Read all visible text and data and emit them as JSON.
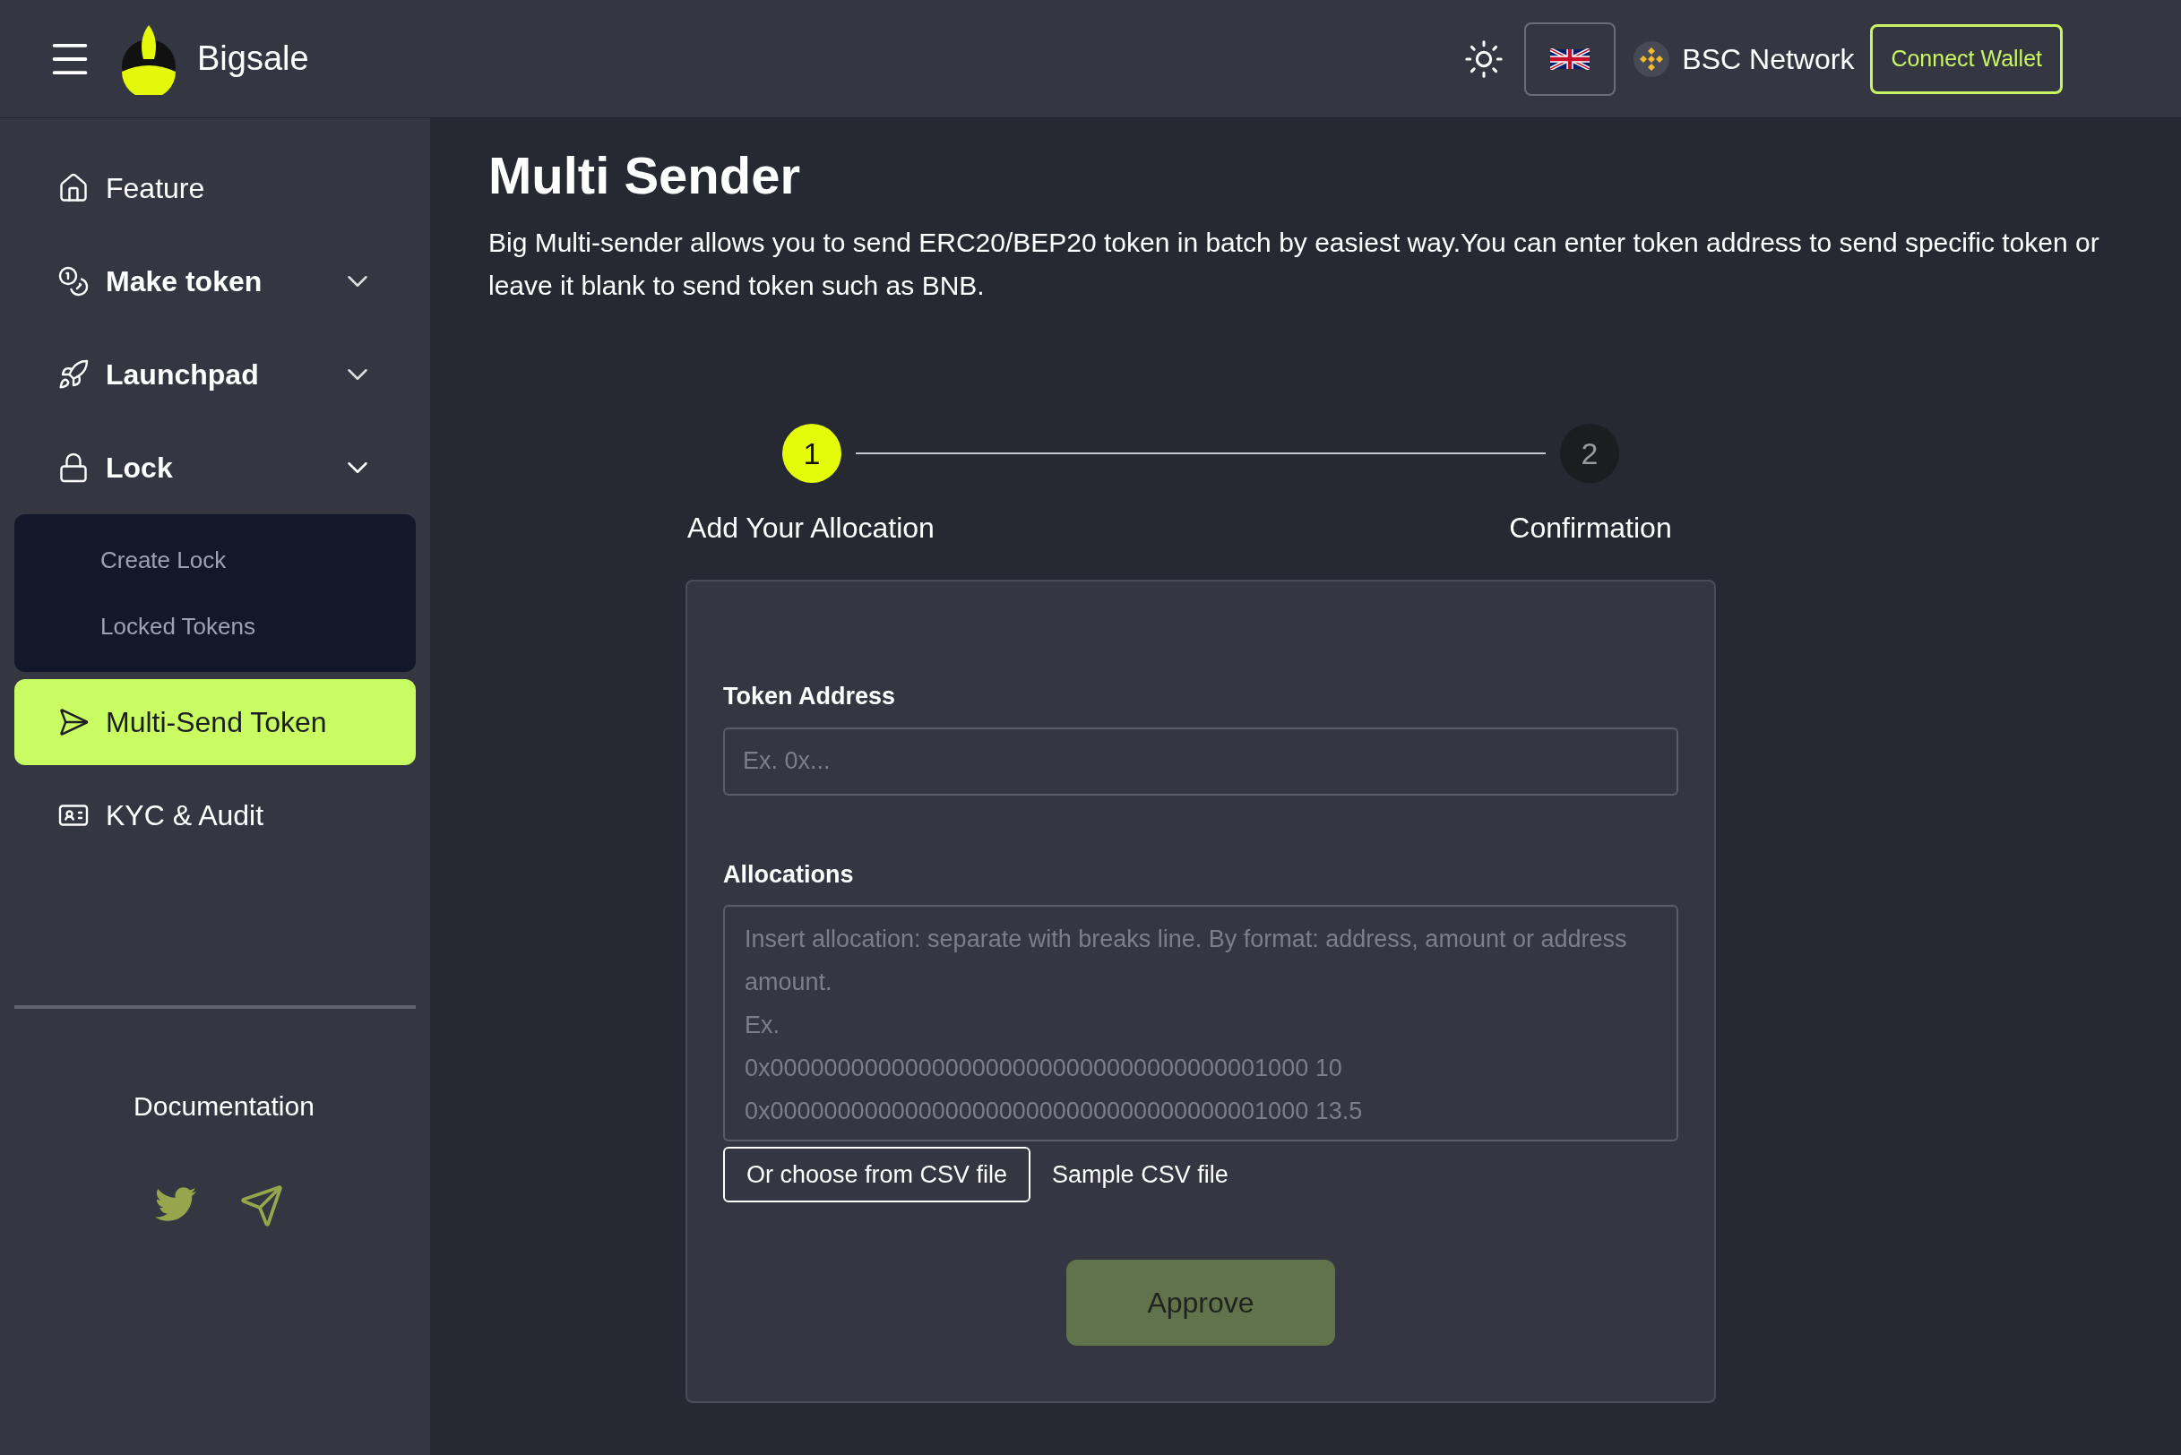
{
  "header": {
    "brand": "Bigsale",
    "network": "BSC Network",
    "connect_button": "Connect Wallet"
  },
  "sidebar": {
    "items": [
      {
        "kind": "home",
        "label": "Feature",
        "selected": false
      },
      {
        "kind": "coins",
        "label": "Make token",
        "selected": false,
        "expanded": false
      },
      {
        "kind": "rocket",
        "label": "Launchpad",
        "selected": false,
        "expanded": false
      },
      {
        "kind": "lock",
        "label": "Lock",
        "selected": false,
        "expanded": true,
        "children": [
          {
            "label": "Create Lock"
          },
          {
            "label": "Locked Tokens"
          }
        ]
      },
      {
        "kind": "send",
        "label": "Multi-Send Token",
        "selected": true
      },
      {
        "kind": "card",
        "label": "KYC & Audit",
        "selected": false
      }
    ],
    "documentation": "Documentation"
  },
  "page": {
    "title": "Multi Sender",
    "description": "Big Multi-sender allows you to send ERC20/BEP20 token in batch by easiest way.You can enter token address to send specific token or leave it blank to send token such as BNB."
  },
  "steps": [
    {
      "number": "1",
      "label": "Add Your Allocation",
      "selected": true
    },
    {
      "number": "2",
      "label": "Confirmation",
      "selected": false
    }
  ],
  "form": {
    "token_address": {
      "label": "Token Address",
      "placeholder": "Ex. 0x..."
    },
    "allocations": {
      "label": "Allocations",
      "placeholder": "Insert allocation: separate with breaks line. By format: address, amount or address amount.\nEx.\n0x0000000000000000000000000000000000001000 10\n0x0000000000000000000000000000000000001000 13.5"
    },
    "csv_button": "Or choose from CSV file",
    "sample_link": "Sample CSV file",
    "approve_button": "Approve"
  }
}
